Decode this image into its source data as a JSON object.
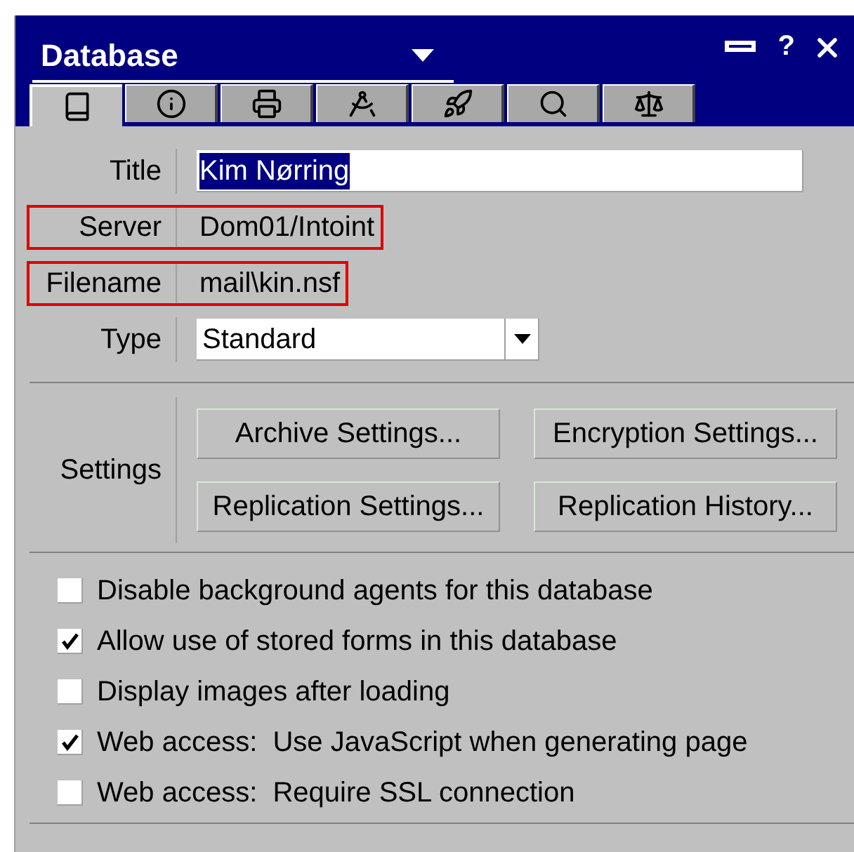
{
  "window": {
    "title": "Database",
    "help": "?"
  },
  "tabs": [
    {
      "selected": true
    },
    {
      "selected": false
    },
    {
      "selected": false
    },
    {
      "selected": false
    },
    {
      "selected": false
    },
    {
      "selected": false
    },
    {
      "selected": false
    }
  ],
  "fields": [
    {
      "kind": "input",
      "label": "Title",
      "value": "Kim Nørring",
      "highlighted": false
    },
    {
      "kind": "text",
      "label": "Server",
      "value": "Dom01/Intoint",
      "highlighted": true
    },
    {
      "kind": "text",
      "label": "Filename",
      "value": "mail\\kin.nsf",
      "highlighted": true
    },
    {
      "kind": "select",
      "label": "Type",
      "value": "Standard",
      "highlighted": false
    }
  ],
  "settings": {
    "label": "Settings",
    "buttons": [
      "Archive Settings...",
      "Encryption Settings...",
      "Replication Settings...",
      "Replication History..."
    ]
  },
  "options": [
    {
      "label": "Disable background agents for this database",
      "checked": false
    },
    {
      "label": "Allow use of stored forms in this database",
      "checked": true
    },
    {
      "label": "Display images after loading",
      "checked": false
    },
    {
      "label": "Web access:  Use JavaScript when generating page",
      "checked": true
    },
    {
      "label": "Web access:  Require SSL connection",
      "checked": false
    }
  ]
}
